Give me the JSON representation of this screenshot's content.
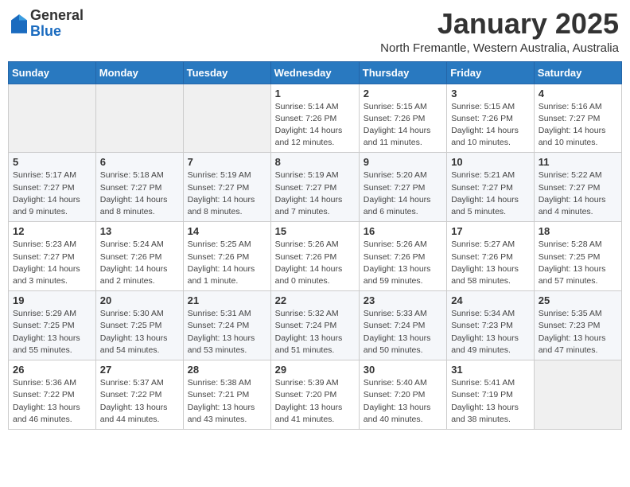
{
  "header": {
    "logo_general": "General",
    "logo_blue": "Blue",
    "month_title": "January 2025",
    "subtitle": "North Fremantle, Western Australia, Australia"
  },
  "weekdays": [
    "Sunday",
    "Monday",
    "Tuesday",
    "Wednesday",
    "Thursday",
    "Friday",
    "Saturday"
  ],
  "weeks": [
    [
      {
        "day": "",
        "info": ""
      },
      {
        "day": "",
        "info": ""
      },
      {
        "day": "",
        "info": ""
      },
      {
        "day": "1",
        "info": "Sunrise: 5:14 AM\nSunset: 7:26 PM\nDaylight: 14 hours\nand 12 minutes."
      },
      {
        "day": "2",
        "info": "Sunrise: 5:15 AM\nSunset: 7:26 PM\nDaylight: 14 hours\nand 11 minutes."
      },
      {
        "day": "3",
        "info": "Sunrise: 5:15 AM\nSunset: 7:26 PM\nDaylight: 14 hours\nand 10 minutes."
      },
      {
        "day": "4",
        "info": "Sunrise: 5:16 AM\nSunset: 7:27 PM\nDaylight: 14 hours\nand 10 minutes."
      }
    ],
    [
      {
        "day": "5",
        "info": "Sunrise: 5:17 AM\nSunset: 7:27 PM\nDaylight: 14 hours\nand 9 minutes."
      },
      {
        "day": "6",
        "info": "Sunrise: 5:18 AM\nSunset: 7:27 PM\nDaylight: 14 hours\nand 8 minutes."
      },
      {
        "day": "7",
        "info": "Sunrise: 5:19 AM\nSunset: 7:27 PM\nDaylight: 14 hours\nand 8 minutes."
      },
      {
        "day": "8",
        "info": "Sunrise: 5:19 AM\nSunset: 7:27 PM\nDaylight: 14 hours\nand 7 minutes."
      },
      {
        "day": "9",
        "info": "Sunrise: 5:20 AM\nSunset: 7:27 PM\nDaylight: 14 hours\nand 6 minutes."
      },
      {
        "day": "10",
        "info": "Sunrise: 5:21 AM\nSunset: 7:27 PM\nDaylight: 14 hours\nand 5 minutes."
      },
      {
        "day": "11",
        "info": "Sunrise: 5:22 AM\nSunset: 7:27 PM\nDaylight: 14 hours\nand 4 minutes."
      }
    ],
    [
      {
        "day": "12",
        "info": "Sunrise: 5:23 AM\nSunset: 7:27 PM\nDaylight: 14 hours\nand 3 minutes."
      },
      {
        "day": "13",
        "info": "Sunrise: 5:24 AM\nSunset: 7:26 PM\nDaylight: 14 hours\nand 2 minutes."
      },
      {
        "day": "14",
        "info": "Sunrise: 5:25 AM\nSunset: 7:26 PM\nDaylight: 14 hours\nand 1 minute."
      },
      {
        "day": "15",
        "info": "Sunrise: 5:26 AM\nSunset: 7:26 PM\nDaylight: 14 hours\nand 0 minutes."
      },
      {
        "day": "16",
        "info": "Sunrise: 5:26 AM\nSunset: 7:26 PM\nDaylight: 13 hours\nand 59 minutes."
      },
      {
        "day": "17",
        "info": "Sunrise: 5:27 AM\nSunset: 7:26 PM\nDaylight: 13 hours\nand 58 minutes."
      },
      {
        "day": "18",
        "info": "Sunrise: 5:28 AM\nSunset: 7:25 PM\nDaylight: 13 hours\nand 57 minutes."
      }
    ],
    [
      {
        "day": "19",
        "info": "Sunrise: 5:29 AM\nSunset: 7:25 PM\nDaylight: 13 hours\nand 55 minutes."
      },
      {
        "day": "20",
        "info": "Sunrise: 5:30 AM\nSunset: 7:25 PM\nDaylight: 13 hours\nand 54 minutes."
      },
      {
        "day": "21",
        "info": "Sunrise: 5:31 AM\nSunset: 7:24 PM\nDaylight: 13 hours\nand 53 minutes."
      },
      {
        "day": "22",
        "info": "Sunrise: 5:32 AM\nSunset: 7:24 PM\nDaylight: 13 hours\nand 51 minutes."
      },
      {
        "day": "23",
        "info": "Sunrise: 5:33 AM\nSunset: 7:24 PM\nDaylight: 13 hours\nand 50 minutes."
      },
      {
        "day": "24",
        "info": "Sunrise: 5:34 AM\nSunset: 7:23 PM\nDaylight: 13 hours\nand 49 minutes."
      },
      {
        "day": "25",
        "info": "Sunrise: 5:35 AM\nSunset: 7:23 PM\nDaylight: 13 hours\nand 47 minutes."
      }
    ],
    [
      {
        "day": "26",
        "info": "Sunrise: 5:36 AM\nSunset: 7:22 PM\nDaylight: 13 hours\nand 46 minutes."
      },
      {
        "day": "27",
        "info": "Sunrise: 5:37 AM\nSunset: 7:22 PM\nDaylight: 13 hours\nand 44 minutes."
      },
      {
        "day": "28",
        "info": "Sunrise: 5:38 AM\nSunset: 7:21 PM\nDaylight: 13 hours\nand 43 minutes."
      },
      {
        "day": "29",
        "info": "Sunrise: 5:39 AM\nSunset: 7:20 PM\nDaylight: 13 hours\nand 41 minutes."
      },
      {
        "day": "30",
        "info": "Sunrise: 5:40 AM\nSunset: 7:20 PM\nDaylight: 13 hours\nand 40 minutes."
      },
      {
        "day": "31",
        "info": "Sunrise: 5:41 AM\nSunset: 7:19 PM\nDaylight: 13 hours\nand 38 minutes."
      },
      {
        "day": "",
        "info": ""
      }
    ]
  ]
}
